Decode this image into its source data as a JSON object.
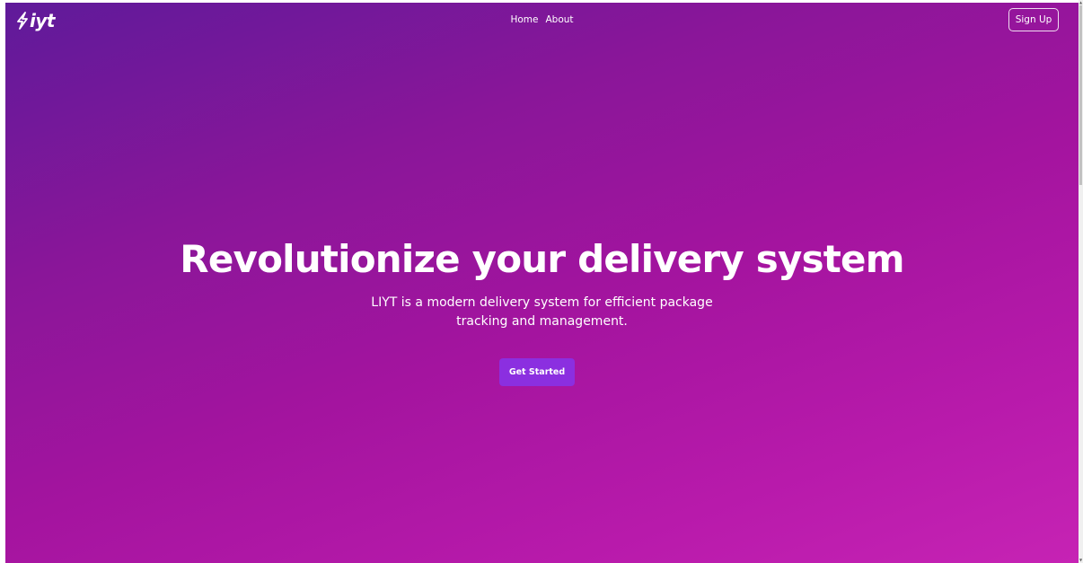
{
  "navbar": {
    "logo_text": "iyt",
    "links": [
      {
        "label": "Home"
      },
      {
        "label": "About"
      }
    ],
    "signup_label": "Sign Up"
  },
  "hero": {
    "title": "Revolutionize your delivery system",
    "subtitle": "LIYT is a modern delivery system for efficient package tracking and management.",
    "cta_label": "Get Started"
  },
  "colors": {
    "gradient_start": "#5f1a9a",
    "gradient_end": "#c623b4",
    "cta_background": "#8b2fe0",
    "text": "#ffffff"
  },
  "icons": {
    "logo": "lightning-bolt-icon",
    "scroll_up": "triangle-up-icon",
    "scroll_down": "triangle-down-icon"
  }
}
